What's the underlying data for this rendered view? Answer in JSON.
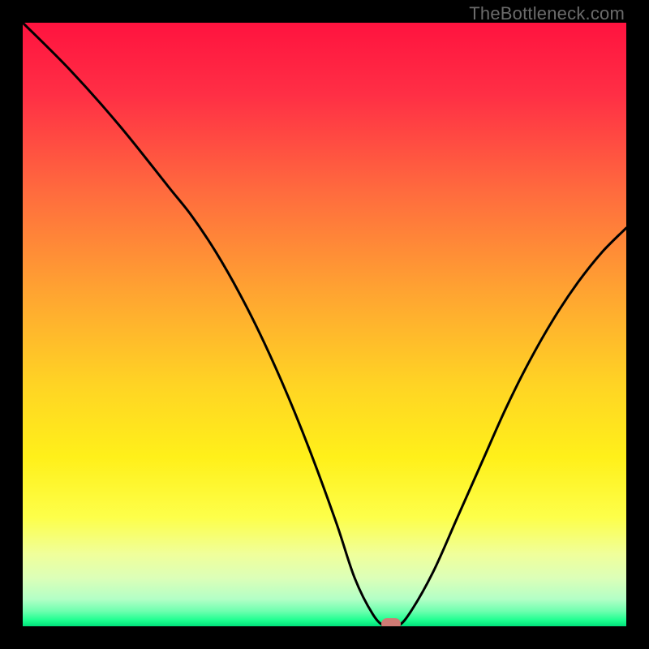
{
  "watermark": "TheBottleneck.com",
  "marker_color": "#cf7a74",
  "chart_data": {
    "type": "line",
    "title": "",
    "xlabel": "",
    "ylabel": "",
    "xlim": [
      0,
      100
    ],
    "ylim": [
      0,
      100
    ],
    "series": [
      {
        "name": "bottleneck-curve",
        "x": [
          0,
          8,
          16,
          24,
          28,
          32,
          36,
          40,
          44,
          48,
          52,
          55,
          58,
          60,
          62,
          64,
          68,
          72,
          76,
          80,
          84,
          88,
          92,
          96,
          100
        ],
        "y": [
          100,
          92,
          83,
          73,
          68,
          62,
          55,
          47,
          38,
          28,
          17,
          8,
          2,
          0,
          0,
          2,
          9,
          18,
          27,
          36,
          44,
          51,
          57,
          62,
          66
        ]
      }
    ],
    "gradient_stops": [
      {
        "offset": 0.0,
        "color": "#ff133f"
      },
      {
        "offset": 0.12,
        "color": "#ff2f45"
      },
      {
        "offset": 0.28,
        "color": "#ff6b3e"
      },
      {
        "offset": 0.45,
        "color": "#ffa531"
      },
      {
        "offset": 0.6,
        "color": "#ffd424"
      },
      {
        "offset": 0.72,
        "color": "#fff01a"
      },
      {
        "offset": 0.82,
        "color": "#fdff4a"
      },
      {
        "offset": 0.88,
        "color": "#f0ff9a"
      },
      {
        "offset": 0.92,
        "color": "#dcffb8"
      },
      {
        "offset": 0.955,
        "color": "#b3ffc6"
      },
      {
        "offset": 0.975,
        "color": "#6effaf"
      },
      {
        "offset": 0.99,
        "color": "#1dff90"
      },
      {
        "offset": 1.0,
        "color": "#00e07a"
      }
    ],
    "marker": {
      "x": 61,
      "y": 0
    }
  }
}
